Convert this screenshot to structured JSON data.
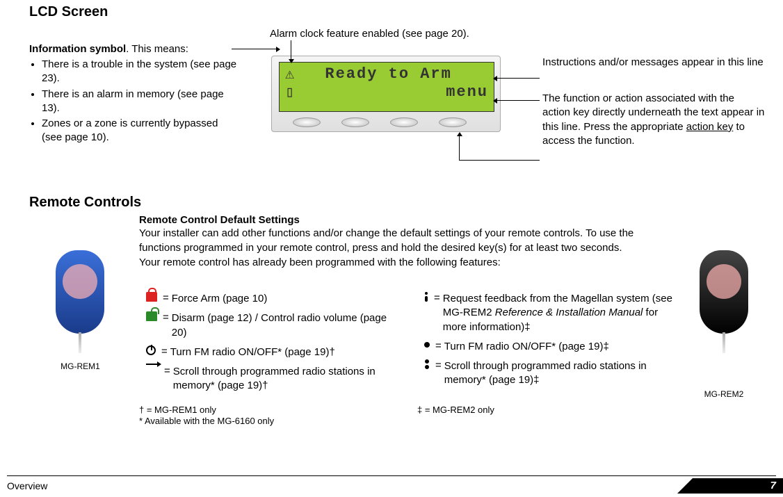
{
  "lcd": {
    "heading": "LCD Screen",
    "info_label": "Information symbol",
    "info_suffix": ". This means:",
    "bullets": [
      "There is a trouble in the system (see page 23).",
      "There is an alarm in memory (see page 13).",
      "Zones or a zone is currently bypassed (see page 10)."
    ],
    "alarm_note": "Alarm clock feature enabled (see page 20).",
    "line1_left": "⚠",
    "line1_text": "Ready to Arm",
    "line2_left": "▯",
    "line2_right": "menu",
    "right_note1": "Instructions and/or messages appear in this line",
    "right_note2a": "The function or action associated with the action key directly underneath the text appear in this line. Press the appropriate ",
    "right_note2b": "action key",
    "right_note2c": " to access the function."
  },
  "remote": {
    "heading": "Remote Controls",
    "sub_heading": "Remote Control Default Settings",
    "intro": "Your installer can add other functions and/or change the default settings of your remote controls. To use the functions programmed in your remote control, press and hold the desired key(s) for at least two seconds. Your remote control has already been programmed with the following features:",
    "left": {
      "r1": "Force Arm (page 10)",
      "r2": "Disarm (page 12) / Control radio volume (page 20)",
      "r3": "Turn FM radio ON/OFF* (page 19)†",
      "r4": "Scroll through programmed radio stations in memory* (page 19)†"
    },
    "right": {
      "r1a": "Request feedback from the Magellan system (see MG-REM2 ",
      "r1b": "Reference & Installation Manual",
      "r1c": " for more information)‡",
      "r2": "Turn FM radio ON/OFF* (page 19)‡",
      "r3": "Scroll through programmed radio stations in memory* (page 19)‡"
    },
    "rem1_label": "MG-REM1",
    "rem2_label": "MG-REM2",
    "foot_dagger": "† = MG-REM1 only",
    "foot_star": "* Available with the MG-6160 only",
    "foot_ddagger": "‡ = MG-REM2 only"
  },
  "eq": "=",
  "footer": {
    "left": "Overview",
    "page": "7"
  }
}
